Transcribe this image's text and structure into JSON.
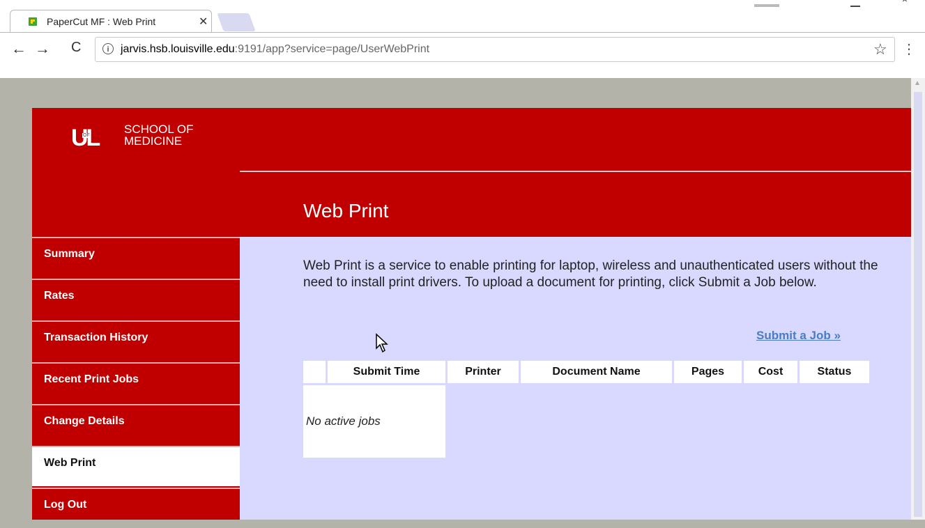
{
  "browser": {
    "tab_title": "PaperCut MF : Web Print",
    "tab_close": "✕",
    "url_prefix": "jarvis.hsb.louisville.edu",
    "url_suffix": ":9191/app?service=page/UserWebPrint"
  },
  "site": {
    "logo_mark": "UL",
    "logo_of": "OF",
    "logo_line1": "SCHOOL OF",
    "logo_line2": "MEDICINE",
    "page_title": "Web Print"
  },
  "sidebar": {
    "items": [
      {
        "label": "Summary"
      },
      {
        "label": "Rates"
      },
      {
        "label": "Transaction History"
      },
      {
        "label": "Recent Print Jobs"
      },
      {
        "label": "Change Details"
      },
      {
        "label": "Web Print",
        "active": true
      },
      {
        "label": "Log Out"
      }
    ]
  },
  "main": {
    "intro": "Web Print is a service to enable printing for laptop, wireless and unauthenticated users without the need to install print drivers. To upload a document for printing, click Submit a Job below.",
    "submit_link": "Submit a Job »",
    "table": {
      "columns": [
        "",
        "Submit Time",
        "Printer",
        "Document Name",
        "Pages",
        "Cost",
        "Status"
      ],
      "empty_message": "No active jobs"
    }
  },
  "colors": {
    "brand_red": "#c00000",
    "content_bg": "#d9d9ff",
    "link": "#4a7cc4"
  }
}
